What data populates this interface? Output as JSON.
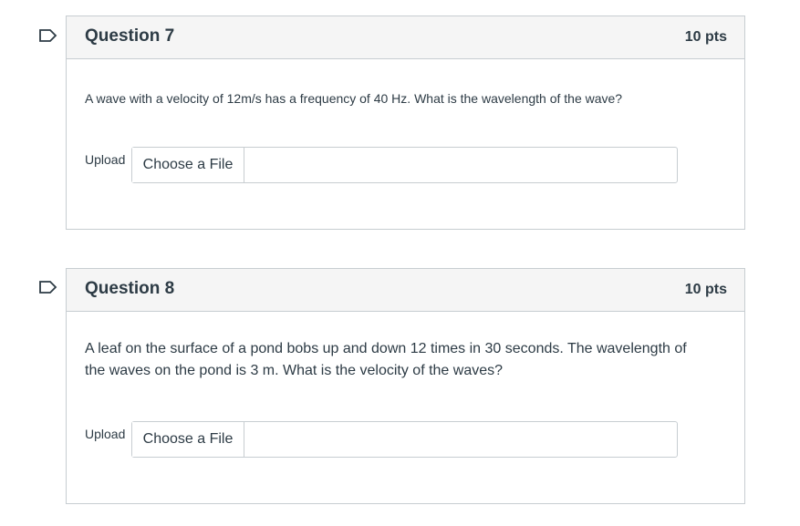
{
  "questions": [
    {
      "title": "Question 7",
      "points": "10 pts",
      "text": "A wave with a velocity of 12m/s has a frequency of 40 Hz. What is the wavelength of the wave?",
      "upload_label": "Upload",
      "file_button": "Choose a File"
    },
    {
      "title": "Question 8",
      "points": "10 pts",
      "text": "A leaf on the surface of a pond bobs up and down 12 times in 30 seconds. The wavelength of the waves on the pond is 3 m. What is the velocity of the waves?",
      "upload_label": "Upload",
      "file_button": "Choose a File"
    }
  ],
  "icons": {
    "flag": "flag-question-icon"
  },
  "colors": {
    "text": "#2d3b45",
    "border": "#c7cdd1",
    "header_bg": "#f5f5f5"
  }
}
